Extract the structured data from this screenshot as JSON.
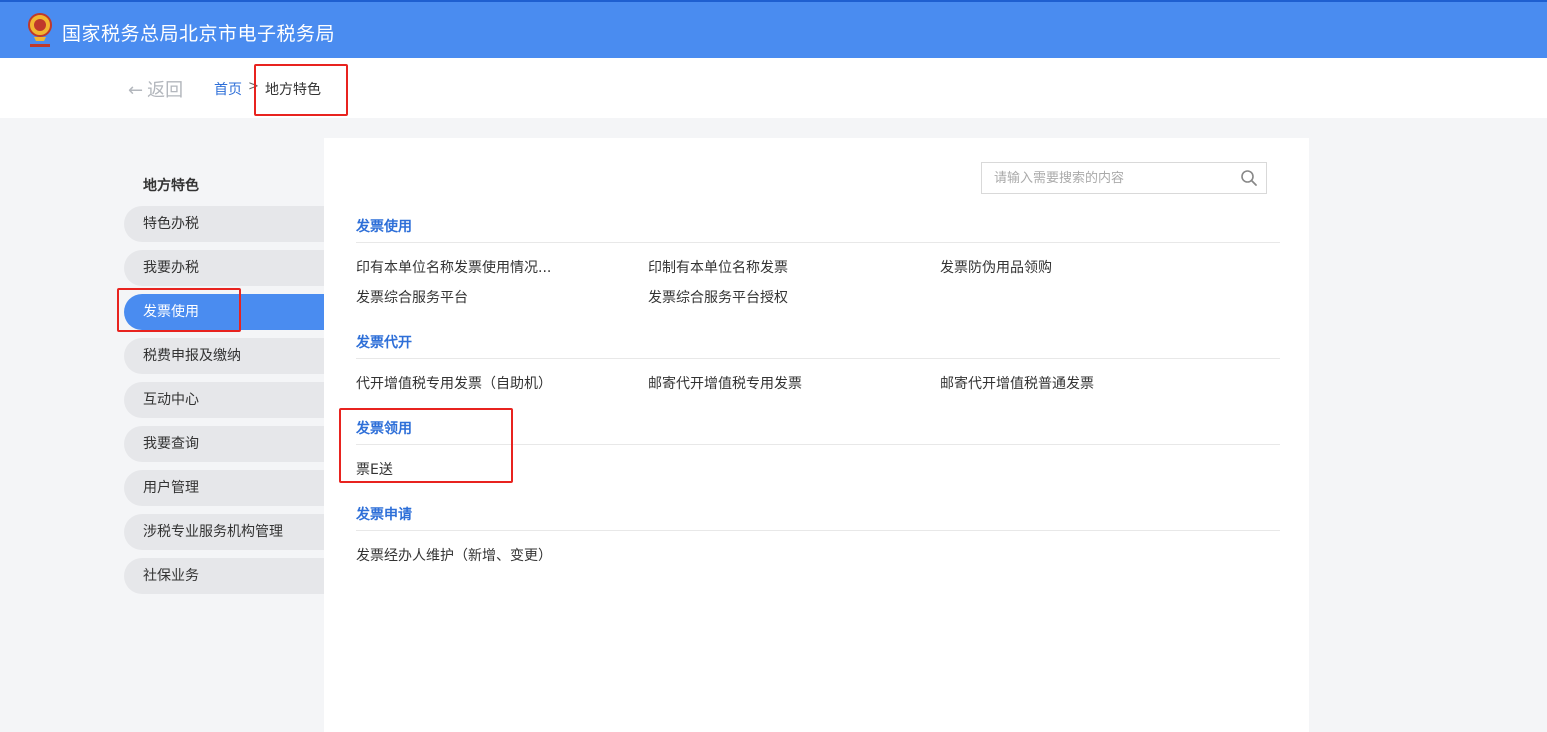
{
  "header": {
    "site_title": "国家税务总局北京市电子税务局"
  },
  "breadcrumb": {
    "back_label": "返回",
    "home_label": "首页",
    "separator": ">",
    "current_label": "地方特色"
  },
  "sidebar": {
    "title": "地方特色",
    "items": [
      {
        "label": "特色办税"
      },
      {
        "label": "我要办税"
      },
      {
        "label": "发票使用"
      },
      {
        "label": "税费申报及缴纳"
      },
      {
        "label": "互动中心"
      },
      {
        "label": "我要查询"
      },
      {
        "label": "用户管理"
      },
      {
        "label": "涉税专业服务机构管理"
      },
      {
        "label": "社保业务"
      }
    ],
    "active_item": "发票使用"
  },
  "search": {
    "placeholder": "请输入需要搜索的内容",
    "value": ""
  },
  "sections": [
    {
      "title": "发票使用",
      "links": [
        "印有本单位名称发票使用情况...",
        "印制有本单位名称发票",
        "发票防伪用品领购",
        "发票综合服务平台",
        "发票综合服务平台授权"
      ]
    },
    {
      "title": "发票代开",
      "links": [
        "代开增值税专用发票（自助机）",
        "邮寄代开增值税专用发票",
        "邮寄代开增值税普通发票"
      ]
    },
    {
      "title": "发票领用",
      "links": [
        "票E送"
      ]
    },
    {
      "title": "发票申请",
      "links": [
        "发票经办人维护（新增、变更）"
      ]
    }
  ],
  "colors": {
    "header_bg": "#4a8cf0",
    "accent": "#2e6fd8",
    "highlight": "#e8231f"
  }
}
